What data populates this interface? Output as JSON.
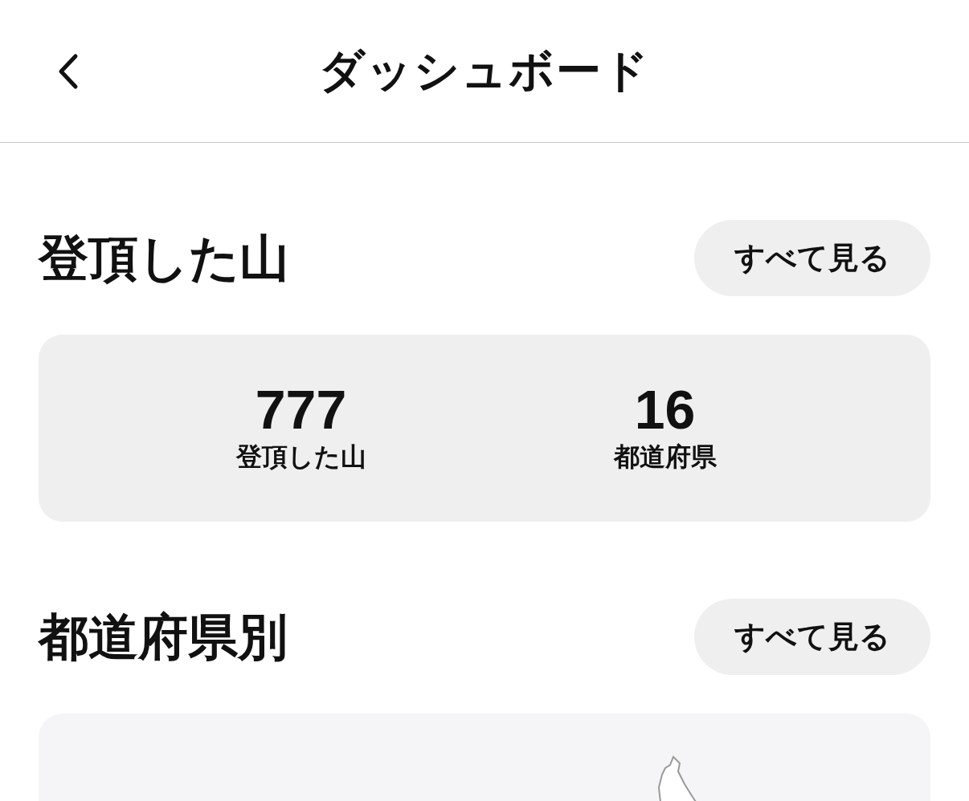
{
  "header": {
    "title": "ダッシュボード"
  },
  "sections": [
    {
      "kind": "stats",
      "title": "登頂した山",
      "button": "すべて見る",
      "stats": [
        {
          "value": "777",
          "label": "登頂した山"
        },
        {
          "value": "16",
          "label": "都道府県"
        }
      ]
    },
    {
      "kind": "map",
      "title": "都道府県別",
      "button": "すべて見る"
    }
  ]
}
